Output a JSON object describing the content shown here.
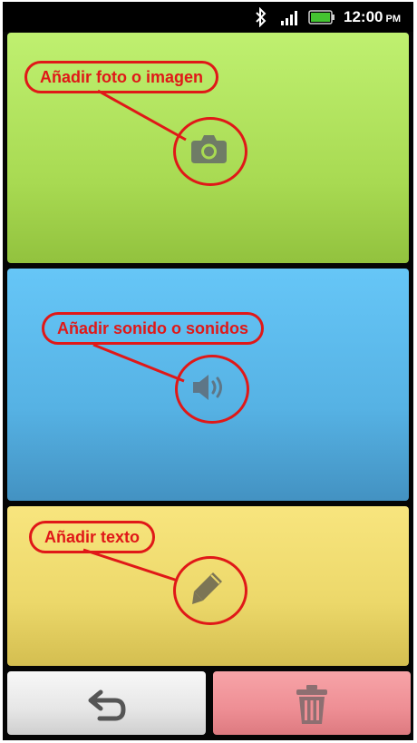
{
  "status_bar": {
    "time": "12:00",
    "ampm": "PM",
    "icons": [
      "bluetooth-icon",
      "signal-icon",
      "battery-icon"
    ]
  },
  "panels": {
    "photo": {
      "label": "Añadir foto o imagen",
      "color": "#a8da52",
      "icon": "camera-icon"
    },
    "sound": {
      "label": "Añadir sonido o sonidos",
      "color": "#56b2e4",
      "icon": "speaker-icon"
    },
    "text": {
      "label": "Añadir texto",
      "color": "#ecd86a",
      "icon": "pencil-icon"
    }
  },
  "buttons": {
    "back": {
      "icon": "undo-arrow-icon",
      "color": "#e6e6e6"
    },
    "delete": {
      "icon": "trash-icon",
      "color": "#ee8e94"
    }
  },
  "annotation_color": "#e01818"
}
